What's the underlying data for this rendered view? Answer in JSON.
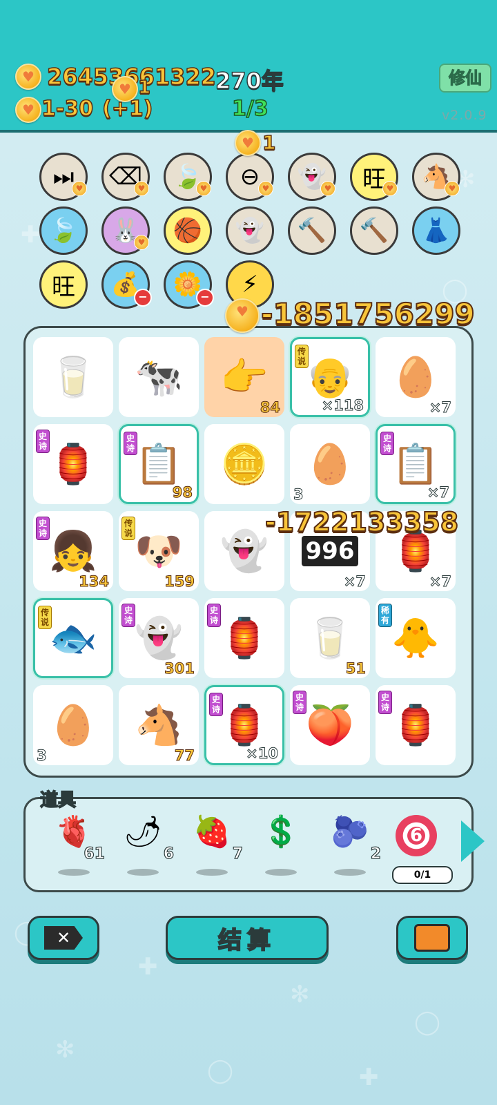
{
  "header": {
    "coins": "26453661322",
    "coin_popup": "1",
    "year": "270年",
    "hearts": "1-30",
    "hearts_gain": "(+1)",
    "stage": "1/3",
    "xiuxian_label": "修仙",
    "version": "v2.0.9"
  },
  "skill_popup": "1",
  "skills": [
    {
      "icon": "skip-icon",
      "glyph": "⏭"
    },
    {
      "icon": "delete-icon",
      "glyph": "⌫"
    },
    {
      "icon": "leaf-icon",
      "glyph": "🍃"
    },
    {
      "icon": "minus-icon",
      "glyph": "⊖"
    },
    {
      "icon": "ghost-icon",
      "glyph": "👻"
    },
    {
      "icon": "wang-tiles-icon",
      "glyph": "旺"
    },
    {
      "icon": "horses-icon",
      "glyph": "🐴"
    },
    {
      "icon": "leaf-icon",
      "glyph": "🍃"
    },
    {
      "icon": "rabbit-icon",
      "glyph": "🐰"
    },
    {
      "icon": "basketballs-icon",
      "glyph": "🏀"
    },
    {
      "icon": "winking-ghost-icon",
      "glyph": "👻"
    },
    {
      "icon": "hammer-icon",
      "glyph": "🔨"
    },
    {
      "icon": "hammer-icon",
      "glyph": "🔨"
    },
    {
      "icon": "skirt-icon",
      "glyph": "👗"
    },
    {
      "icon": "wang-tiles-icon",
      "glyph": "旺"
    },
    {
      "icon": "money-bag-icon",
      "glyph": "💰"
    },
    {
      "icon": "flower-pot-icon",
      "glyph": "🌼"
    },
    {
      "icon": "lightning-icon",
      "glyph": "⚡"
    }
  ],
  "floats": {
    "loss_top": "-1851756299",
    "loss_mid": "-1722133358"
  },
  "board": [
    {
      "icon": "milk-bottle-icon",
      "glyph": "🥛",
      "tag": "",
      "count": "",
      "countLeft": ""
    },
    {
      "icon": "cow-icon",
      "glyph": "🐄",
      "tag": "",
      "count": "",
      "countLeft": ""
    },
    {
      "icon": "pointing-hand-icon",
      "glyph": "👉",
      "tag": "",
      "count": "84",
      "countLeft": ""
    },
    {
      "icon": "old-man-icon",
      "glyph": "👴",
      "tag": "传说",
      "count": "×118",
      "countLeft": ""
    },
    {
      "icon": "egg-icon",
      "glyph": "🥚",
      "tag": "",
      "count": "×7",
      "countLeft": ""
    },
    {
      "icon": "rabbit-house-icon",
      "glyph": "🏮",
      "tag": "史诗",
      "count": "",
      "countLeft": ""
    },
    {
      "icon": "copy-paste-icon",
      "glyph": "📋",
      "tag": "史诗",
      "count": "98",
      "countLeft": ""
    },
    {
      "icon": "coins-burst-icon",
      "glyph": "🪙",
      "tag": "",
      "count": "",
      "countLeft": ""
    },
    {
      "icon": "egg-icon",
      "glyph": "🥚",
      "tag": "",
      "count": "",
      "countLeft": "3"
    },
    {
      "icon": "copy-paste-icon",
      "glyph": "📋",
      "tag": "史诗",
      "count": "×7",
      "countLeft": ""
    },
    {
      "icon": "girl-icon",
      "glyph": "👧",
      "tag": "史诗",
      "count": "134",
      "countLeft": ""
    },
    {
      "icon": "husky-king-icon",
      "glyph": "🐶",
      "tag": "传说",
      "count": "159",
      "countLeft": ""
    },
    {
      "icon": "ghost-icon",
      "glyph": "👻",
      "tag": "",
      "count": "",
      "countLeft": ""
    },
    {
      "icon": "counter-icon",
      "glyph": "996",
      "tag": "",
      "count": "×7",
      "countLeft": ""
    },
    {
      "icon": "rabbit-house-icon",
      "glyph": "🏮",
      "tag": "",
      "count": "×7",
      "countLeft": ""
    },
    {
      "icon": "koi-fish-icon",
      "glyph": "🐟",
      "tag": "传说",
      "count": "",
      "countLeft": ""
    },
    {
      "icon": "ghost-icon",
      "glyph": "👻",
      "tag": "史诗",
      "count": "301",
      "countLeft": ""
    },
    {
      "icon": "rabbit-house-icon",
      "glyph": "🏮",
      "tag": "史诗",
      "count": "",
      "countLeft": ""
    },
    {
      "icon": "milk-bottle-icon",
      "glyph": "🥛",
      "tag": "",
      "count": "51",
      "countLeft": ""
    },
    {
      "icon": "chick-icon",
      "glyph": "🐥",
      "tag": "稀有",
      "count": "",
      "countLeft": ""
    },
    {
      "icon": "egg-icon",
      "glyph": "🥚",
      "tag": "",
      "count": "",
      "countLeft": "3"
    },
    {
      "icon": "horse-icon",
      "glyph": "🐴",
      "tag": "",
      "count": "77",
      "countLeft": ""
    },
    {
      "icon": "rabbit-house-icon",
      "glyph": "🏮",
      "tag": "史诗",
      "count": "×10",
      "countLeft": ""
    },
    {
      "icon": "peach-icon",
      "glyph": "🍑",
      "tag": "史诗",
      "count": "",
      "countLeft": ""
    },
    {
      "icon": "rabbit-house-icon",
      "glyph": "🏮",
      "tag": "史诗",
      "count": "",
      "countLeft": ""
    }
  ],
  "items": {
    "title": "道具",
    "list": [
      {
        "icon": "liver-icon",
        "glyph": "🫀",
        "count": "61"
      },
      {
        "icon": "chili-icon",
        "glyph": "🌶",
        "count": "6"
      },
      {
        "icon": "lychee-icon",
        "glyph": "🍓",
        "count": "7"
      },
      {
        "icon": "dollar-coin-icon",
        "glyph": "💲",
        "count": ""
      },
      {
        "icon": "blueberry-icon",
        "glyph": "🫐",
        "count": "2"
      },
      {
        "icon": "target-six-icon",
        "glyph": "6",
        "count": ""
      }
    ],
    "progress": "0/1"
  },
  "buttons": {
    "settle": "结算"
  },
  "colors": {
    "header_bg": "#2cc6c6",
    "gold_text": "#f8c53a",
    "highlight_border": "#39c0a8",
    "epic_tag": "#c24fd0",
    "legend_tag": "#f6d94a",
    "rare_tag": "#2fa8d8"
  }
}
